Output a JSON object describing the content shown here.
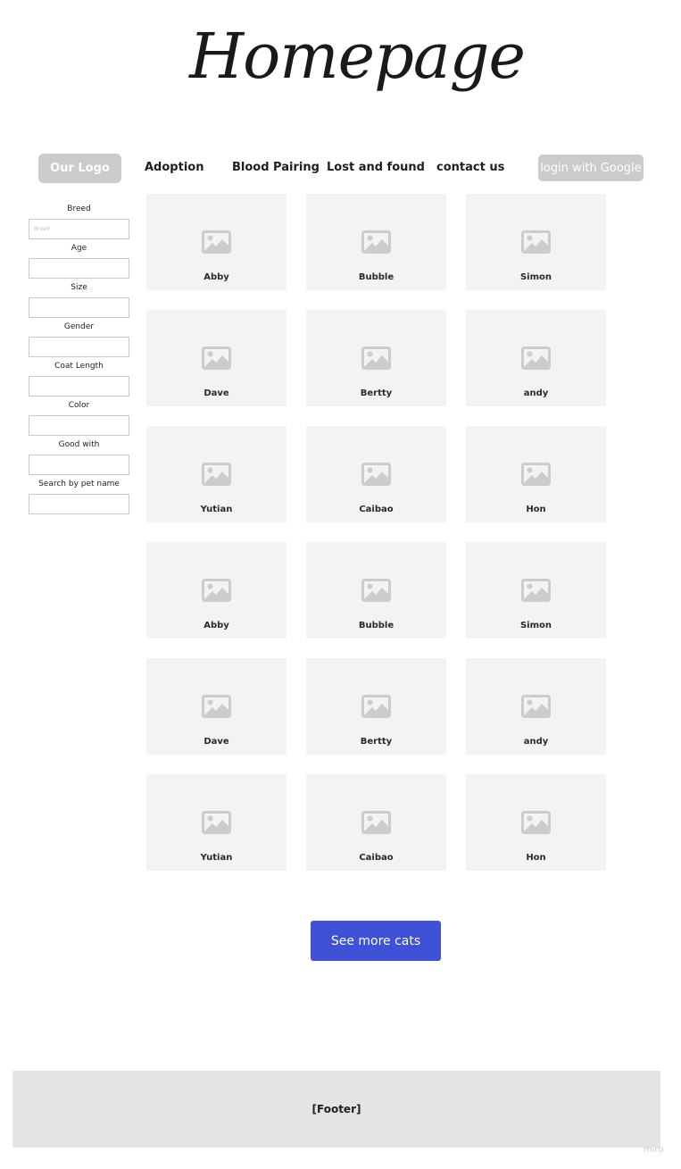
{
  "header": {
    "title": "Homepage",
    "logo": "Our Logo",
    "nav": [
      "Adoption",
      "Blood Pairing",
      "Lost and found",
      "contact us"
    ],
    "login": "login with Google"
  },
  "filters": [
    {
      "label": "Breed",
      "placeholder": "Breed"
    },
    {
      "label": "Age",
      "placeholder": ""
    },
    {
      "label": "Size",
      "placeholder": ""
    },
    {
      "label": "Gender",
      "placeholder": ""
    },
    {
      "label": "Coat Length",
      "placeholder": ""
    },
    {
      "label": "Color",
      "placeholder": ""
    },
    {
      "label": "Good with",
      "placeholder": ""
    },
    {
      "label": "Search by pet name",
      "placeholder": ""
    }
  ],
  "cats": [
    "Abby",
    "Bubble",
    "Simon",
    "Dave",
    "Bertty",
    "andy",
    "Yutian",
    "Caibao",
    "Hon",
    "Abby",
    "Bubble",
    "Simon",
    "Dave",
    "Bertty",
    "andy",
    "Yutian",
    "Caibao",
    "Hon"
  ],
  "see_more": "See more cats",
  "footer": "[Footer]",
  "watermark": "miro",
  "icons": {
    "card": "image-placeholder-icon"
  },
  "colors": {
    "accent": "#3f51d6",
    "card_bg": "#f3f3f3",
    "muted_button": "#cbcbcb",
    "footer_bg": "#e4e4e4"
  }
}
